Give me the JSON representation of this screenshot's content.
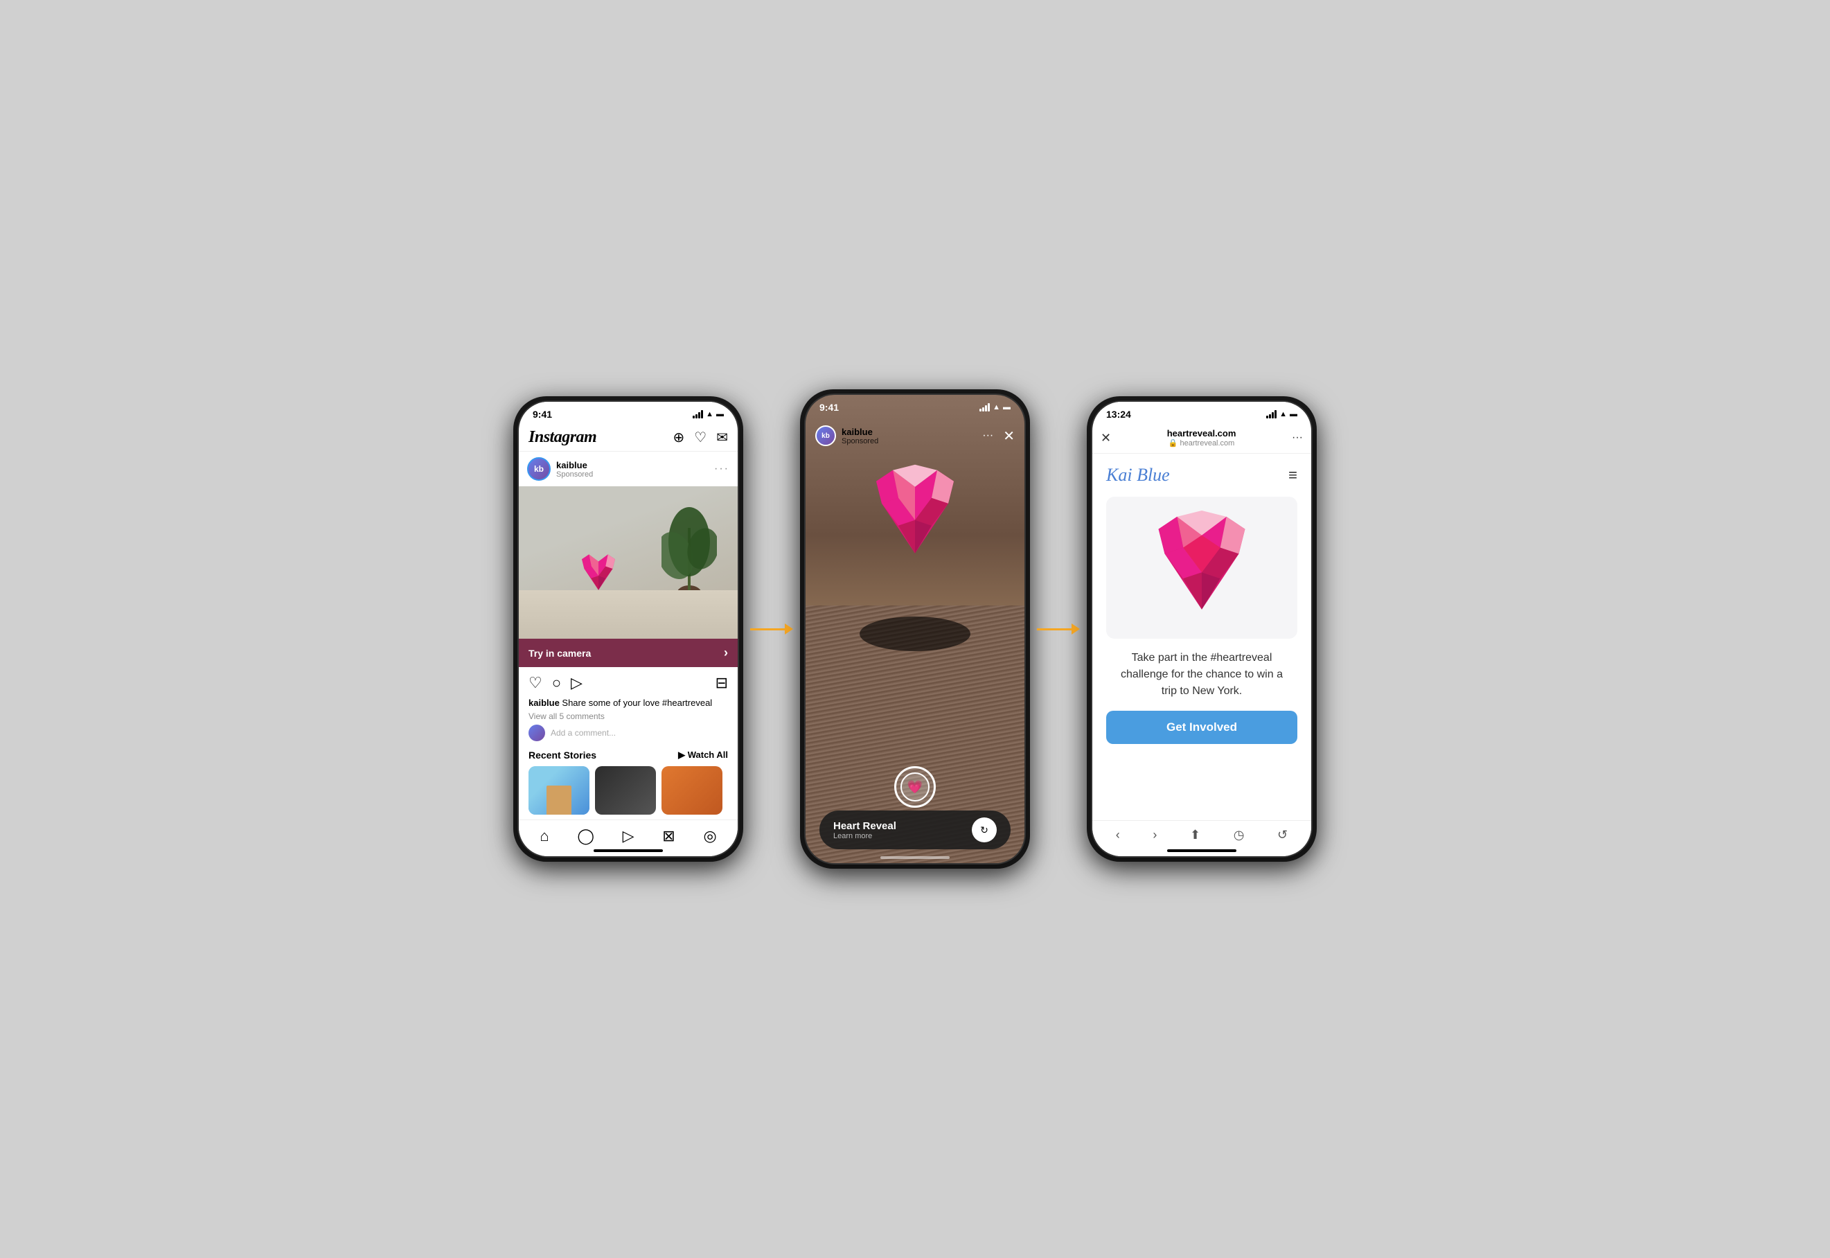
{
  "phone1": {
    "status_time": "9:41",
    "app_name": "Instagram",
    "header_icons": [
      "plus-square",
      "heart",
      "messenger"
    ],
    "post": {
      "username": "kaiblue",
      "sponsored": "Sponsored",
      "try_camera": "Try in camera",
      "caption_user": "kaiblue",
      "caption_text": " Share some of your love #heartreveal",
      "view_comments": "View all 5 comments",
      "add_comment_placeholder": "Add a comment..."
    },
    "recent_stories": {
      "title": "Recent Stories",
      "watch_all": "▶ Watch All"
    },
    "nav_icons": [
      "home",
      "search",
      "video",
      "shop",
      "profile"
    ]
  },
  "phone2": {
    "status_time": "9:41",
    "post": {
      "username": "kaiblue",
      "sponsored": "Sponsored"
    },
    "ar_bar": {
      "title": "Heart Reveal",
      "subtitle": "Learn more"
    }
  },
  "phone3": {
    "status_time": "13:24",
    "browser": {
      "url_title": "heartreveal.com",
      "url_sub": "heartreveal.com",
      "lock_icon": "🔒"
    },
    "site": {
      "logo": "Kai Blue",
      "tagline": "Take part in the #heartreveal challenge for the chance to win a trip to New York.",
      "cta": "Get Involved"
    }
  },
  "arrows": {
    "arrow1_label": "→",
    "arrow2_label": "→"
  },
  "colors": {
    "try_camera_bg": "#7b2d4a",
    "cta_bg": "#4a9de0",
    "heart_pink": "#e0357a",
    "logo_blue": "#4a7fd4"
  }
}
